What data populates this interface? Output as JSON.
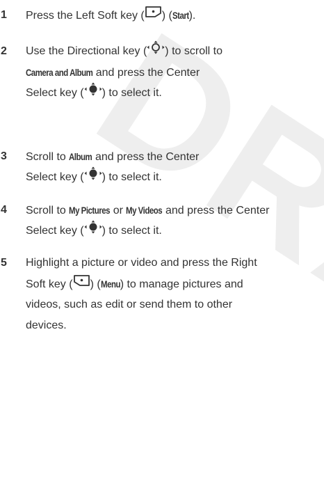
{
  "watermark": "DRAFT",
  "steps": [
    {
      "number": "1",
      "lines": [
        [
          {
            "t": "Press the Left Soft key ("
          },
          {
            "icon": "left-soft-key-icon"
          },
          {
            "t": ") ("
          },
          {
            "b": "Start"
          },
          {
            "t": ")."
          }
        ]
      ]
    },
    {
      "number": "2",
      "lines": [
        [
          {
            "t": "Use the Directional key ("
          },
          {
            "icon": "directional-key-icon"
          },
          {
            "t": ") to scroll to"
          }
        ],
        [
          {
            "b": "Camera and Album"
          },
          {
            "t": " and press the Center"
          }
        ],
        [
          {
            "t": "Select key ("
          },
          {
            "icon": "center-select-key-icon"
          },
          {
            "t": ") to select it."
          }
        ]
      ]
    },
    {
      "number": "3",
      "lines": [
        [
          {
            "t": "Scroll to "
          },
          {
            "b": "Album"
          },
          {
            "t": " and press the Center"
          }
        ],
        [
          {
            "t": "Select key ("
          },
          {
            "icon": "center-select-key-icon"
          },
          {
            "t": ") to select it."
          }
        ]
      ]
    },
    {
      "number": "4",
      "lines": [
        [
          {
            "t": "Scroll to "
          },
          {
            "b": "My Pictures"
          },
          {
            "t": " or "
          },
          {
            "b": "My Videos"
          },
          {
            "t": " and press the Center"
          }
        ],
        [
          {
            "t": "Select key ("
          },
          {
            "icon": "center-select-key-icon"
          },
          {
            "t": ") to select it."
          }
        ]
      ]
    },
    {
      "number": "5",
      "lines": [
        [
          {
            "t": "Highlight a picture or video and press the Right"
          }
        ],
        [
          {
            "t": "Soft key ("
          },
          {
            "icon": "right-soft-key-icon"
          },
          {
            "t": ") ("
          },
          {
            "b": "Menu"
          },
          {
            "t": ") to manage pictures and"
          }
        ],
        [
          {
            "t": "videos, such as edit or send them to other"
          }
        ],
        [
          {
            "t": "devices."
          }
        ]
      ]
    }
  ]
}
